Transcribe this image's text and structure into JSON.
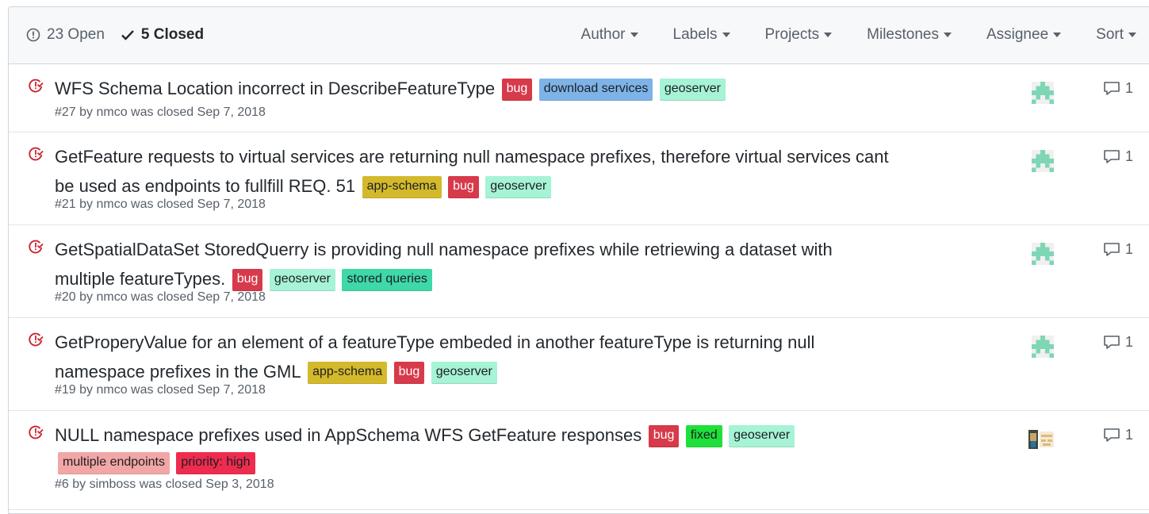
{
  "header": {
    "open_label": "23 Open",
    "closed_label": "5 Closed",
    "filters": [
      "Author",
      "Labels",
      "Projects",
      "Milestones",
      "Assignee",
      "Sort"
    ]
  },
  "issues": [
    {
      "title": "WFS Schema Location incorrect in DescribeFeatureType",
      "labels": [
        {
          "name": "bug",
          "bg": "#d73a4a",
          "fg": "#ffffff"
        },
        {
          "name": "download services",
          "bg": "#7eb3e8",
          "fg": "#1b1f23"
        },
        {
          "name": "geoserver",
          "bg": "#a6f3d5",
          "fg": "#1b1f23"
        }
      ],
      "meta": "#27 by nmco was closed Sep 7, 2018",
      "comments": "1",
      "avatar": "identicon-green"
    },
    {
      "title": "GetFeature requests to virtual services are returning null namespace prefixes, therefore virtual services cant be used as endpoints to fullfill REQ. 51",
      "labels": [
        {
          "name": "app-schema",
          "bg": "#d4b92b",
          "fg": "#1b1f23"
        },
        {
          "name": "bug",
          "bg": "#d73a4a",
          "fg": "#ffffff"
        },
        {
          "name": "geoserver",
          "bg": "#a6f3d5",
          "fg": "#1b1f23"
        }
      ],
      "meta": "#21 by nmco was closed Sep 7, 2018",
      "comments": "1",
      "avatar": "identicon-green"
    },
    {
      "title": "GetSpatialDataSet StoredQuerry is providing null namespace prefixes while retriewing a dataset with multiple featureTypes.",
      "labels": [
        {
          "name": "bug",
          "bg": "#d73a4a",
          "fg": "#ffffff"
        },
        {
          "name": "geoserver",
          "bg": "#a6f3d5",
          "fg": "#1b1f23"
        },
        {
          "name": "stored queries",
          "bg": "#3fd8a8",
          "fg": "#1b1f23"
        }
      ],
      "meta": "#20 by nmco was closed Sep 7, 2018",
      "comments": "1",
      "avatar": "identicon-green"
    },
    {
      "title": "GetProperyValue for an element of a featureType embeded in another featureType is returning null namespace prefixes in the GML",
      "labels": [
        {
          "name": "app-schema",
          "bg": "#d4b92b",
          "fg": "#1b1f23"
        },
        {
          "name": "bug",
          "bg": "#d73a4a",
          "fg": "#ffffff"
        },
        {
          "name": "geoserver",
          "bg": "#a6f3d5",
          "fg": "#1b1f23"
        }
      ],
      "meta": "#19 by nmco was closed Sep 7, 2018",
      "comments": "1",
      "avatar": "identicon-green"
    },
    {
      "title": "NULL namespace prefixes used in AppSchema WFS GetFeature responses",
      "labels": [
        {
          "name": "bug",
          "bg": "#d73a4a",
          "fg": "#ffffff"
        },
        {
          "name": "fixed",
          "bg": "#1fe03a",
          "fg": "#1b1f23"
        },
        {
          "name": "geoserver",
          "bg": "#a6f3d5",
          "fg": "#1b1f23"
        },
        {
          "name": "multiple endpoints",
          "bg": "#f3a6a6",
          "fg": "#1b1f23"
        },
        {
          "name": "priority: high",
          "bg": "#ee2c4f",
          "fg": "#1b1f23"
        }
      ],
      "meta": "#6 by simboss was closed Sep 3, 2018",
      "comments": "1",
      "avatar": "identicon-photo"
    }
  ],
  "colors": {
    "closed_icon": "#cb2431",
    "header_bg": "#f6f8fa",
    "identicon_green": "#7fd6b4"
  }
}
